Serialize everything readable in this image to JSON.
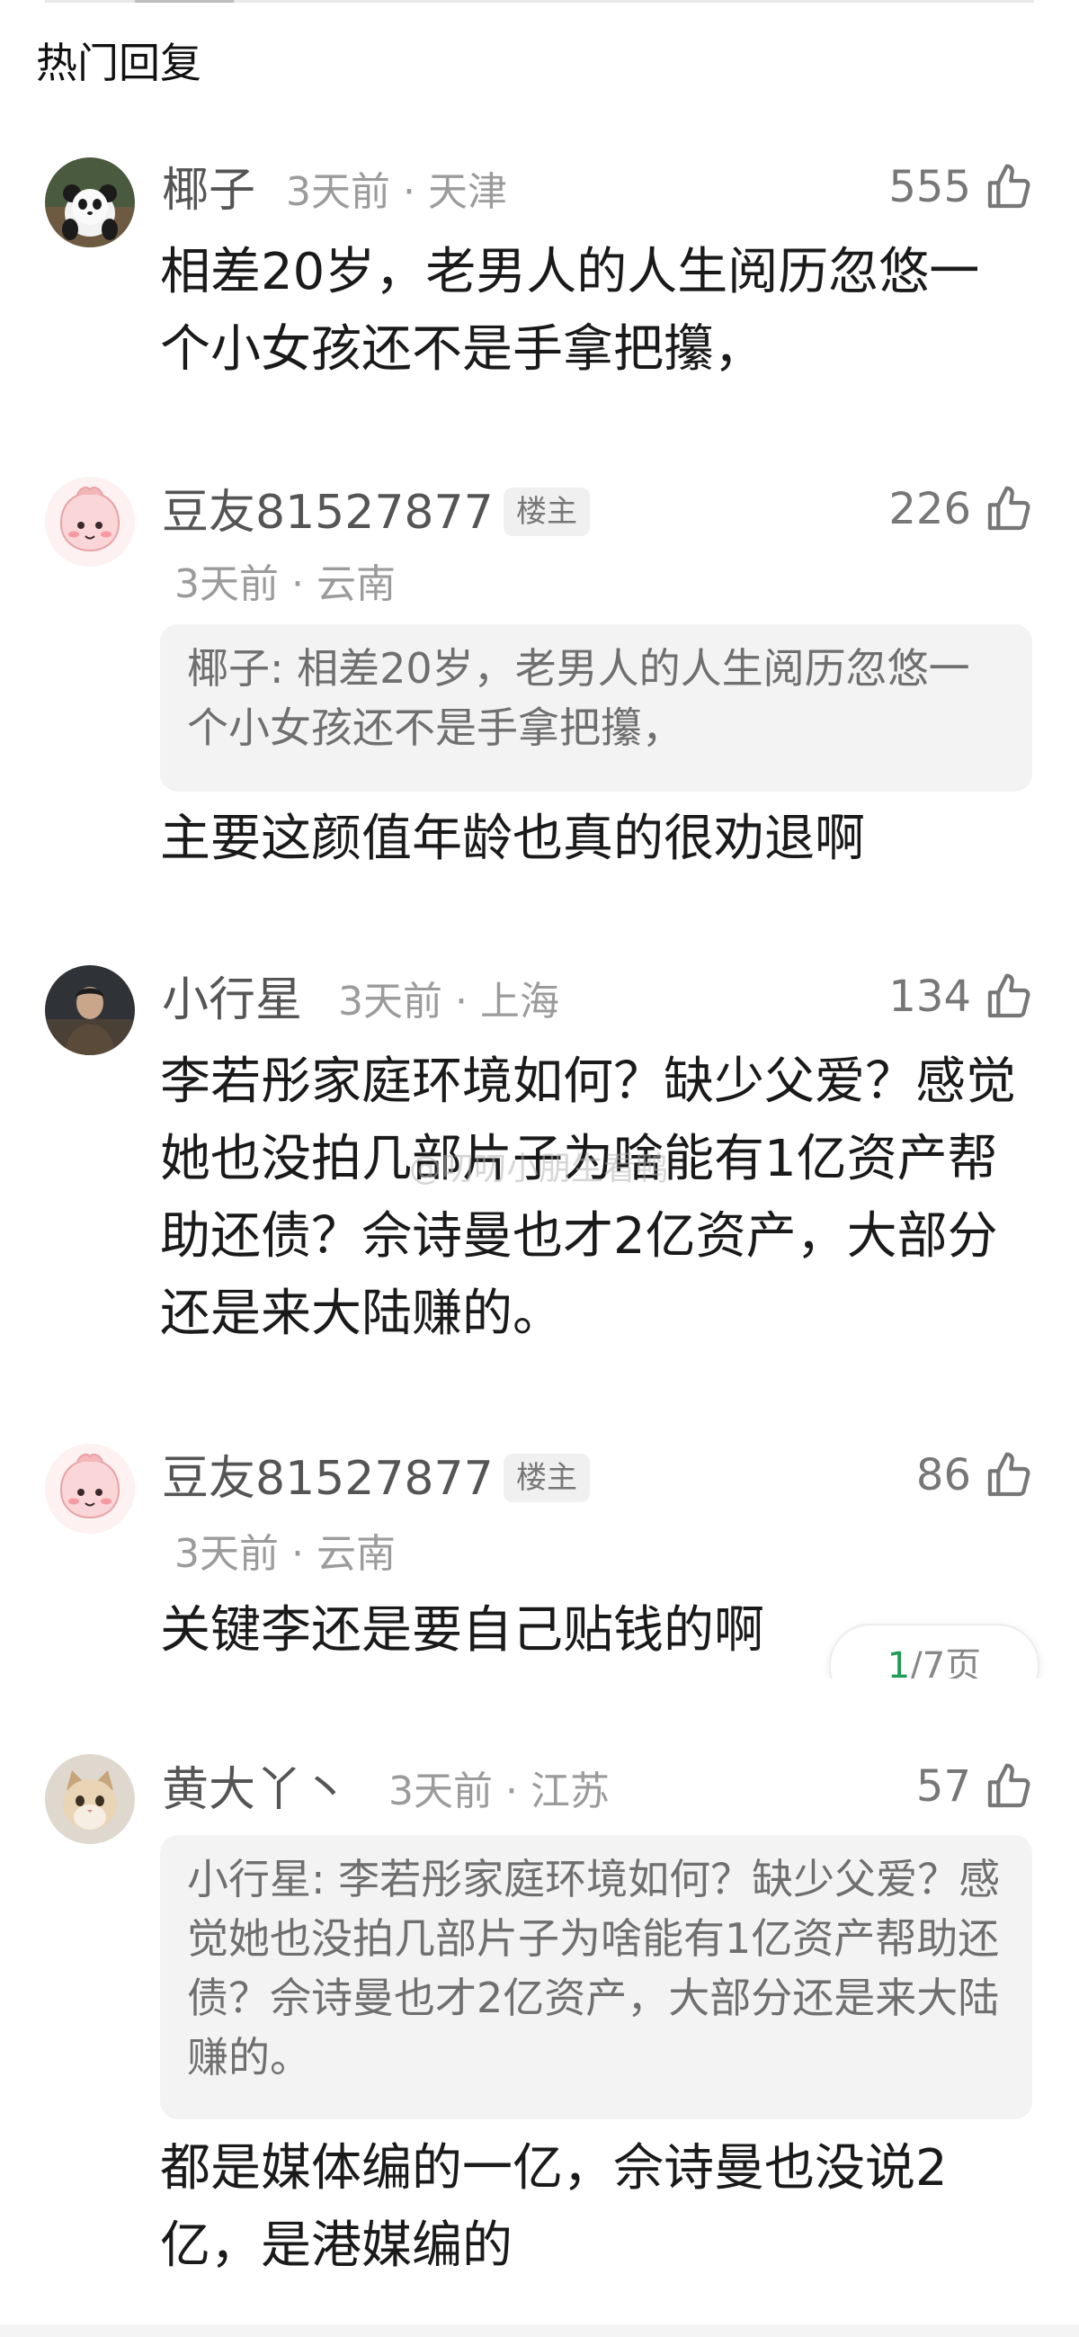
{
  "section": {
    "title": "热门回复"
  },
  "watermark": "@叨叨小朋生看鸭",
  "pager": {
    "current": "1",
    "total_text": "/7页"
  },
  "comments": [
    {
      "avatar": "panda-avatar",
      "name": "椰子",
      "time": "3天前",
      "location": "天津",
      "likes": "555",
      "text": "相差20岁，老男人的人生阅历忽悠一个小女孩还不是手拿把攥，"
    },
    {
      "avatar": "pink-cartoon-avatar",
      "name": "豆友81527877",
      "badge": "楼主",
      "time": "3天前",
      "location": "云南",
      "likes": "226",
      "quote": "椰子: 相差20岁，老男人的人生阅历忽悠一个小女孩还不是手拿把攥，",
      "text": "主要这颜值年龄也真的很劝退啊"
    },
    {
      "avatar": "man-photo-avatar",
      "name": "小行星",
      "time": "3天前",
      "location": "上海",
      "likes": "134",
      "text": "李若彤家庭环境如何？缺少父爱？感觉她也没拍几部片子为啥能有1亿资产帮助还债？佘诗曼也才2亿资产，大部分还是来大陆赚的。"
    },
    {
      "avatar": "pink-cartoon-avatar",
      "name": "豆友81527877",
      "badge": "楼主",
      "time": "3天前",
      "location": "云南",
      "likes": "86",
      "text": "关键李还是要自己贴钱的啊"
    },
    {
      "avatar": "cat-avatar",
      "name": "黄大丫丶",
      "time": "3天前",
      "location": "江苏",
      "likes": "57",
      "quote": "小行星: 李若彤家庭环境如何？缺少父爱？感觉她也没拍几部片子为啥能有1亿资产帮助还债？佘诗曼也才2亿资产，大部分还是来大陆赚的。",
      "text": "都是媒体编的一亿，佘诗曼也没说2亿，是港媒编的"
    }
  ]
}
